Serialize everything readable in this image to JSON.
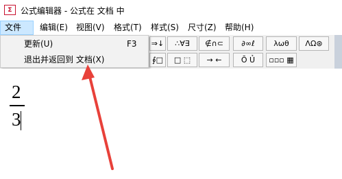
{
  "window": {
    "title": "公式编辑器 - 公式在 文档 中",
    "icon": "formula-editor-icon",
    "icon_text": "Σ"
  },
  "menubar": {
    "items": [
      {
        "label": "文件(F)"
      },
      {
        "label": "编辑(E)"
      },
      {
        "label": "视图(V)"
      },
      {
        "label": "格式(T)"
      },
      {
        "label": "样式(S)"
      },
      {
        "label": "尺寸(Z)"
      },
      {
        "label": "帮助(H)"
      }
    ]
  },
  "file_menu": {
    "items": [
      {
        "label": "更新(U)",
        "shortcut": "F3"
      },
      {
        "label": "退出并返回到 文档(X)",
        "shortcut": ""
      }
    ]
  },
  "toolbar": {
    "row1": [
      "⇒↓",
      "∴∀∃",
      "∉∩⊂",
      "∂∞ℓ",
      "λωθ",
      "ΛΩ⊛"
    ],
    "row2": [
      "∮□",
      "□ ⬚",
      "→ ←",
      "Ō Ủ",
      "▫▫▫ ▦"
    ]
  },
  "document": {
    "numerator": "2",
    "denominator": "3"
  },
  "annotation": {
    "arrow_color": "#e8413a"
  },
  "colors": {
    "menu_highlight": "#cce8ff",
    "item_highlight": "#91c9f7",
    "toolbar_bg": "#f0f0f0"
  }
}
